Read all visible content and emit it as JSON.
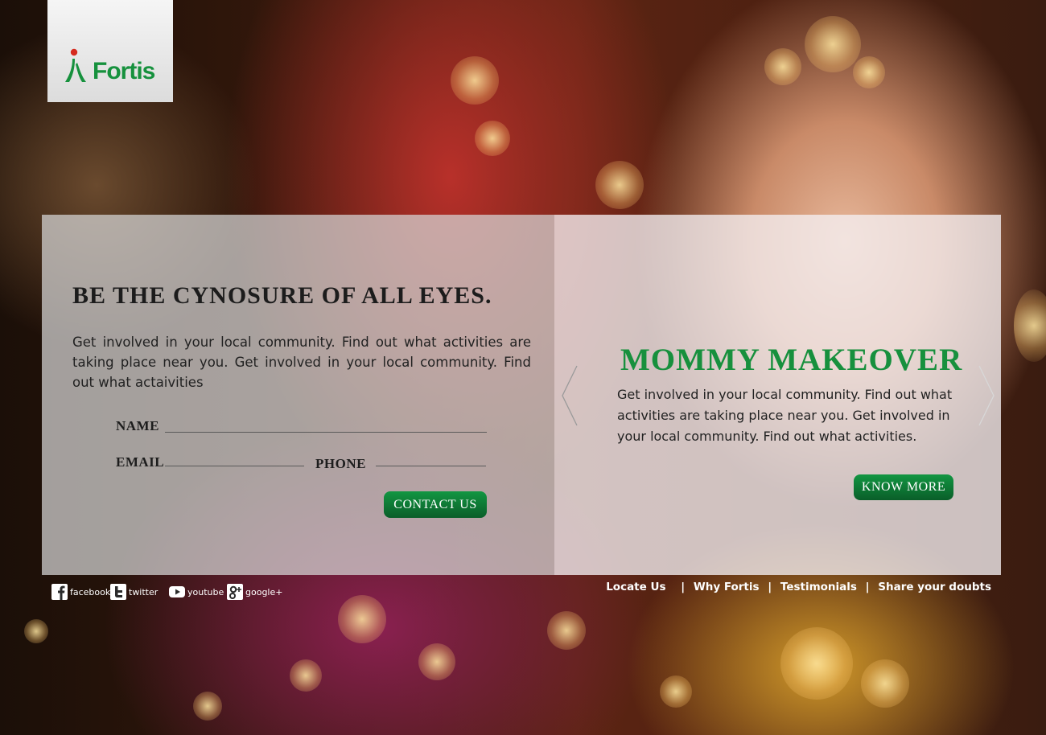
{
  "logo": {
    "text": "Fortis",
    "brand_color": "#16913d"
  },
  "left_panel": {
    "title": "BE THE CYNOSURE OF ALL EYES.",
    "text": "Get involved in your local community. Find out what activities are taking place near you. Get involved in your local community. Find out what actaivities",
    "form": {
      "name_label": "NAME",
      "email_label": "EMAIL",
      "phone_label": "PHONE",
      "name_value": "",
      "email_value": "",
      "phone_value": "",
      "submit_label": "CONTACT US"
    }
  },
  "right_panel": {
    "title": "MOMMY MAKEOVER",
    "text": "Get involved in your local community. Find out what activities are taking place near you. Get involved in your local community. Find out what activities.",
    "button_label": "KNOW MORE",
    "prev_icon": "chevron-left-icon",
    "next_icon": "chevron-right-icon"
  },
  "social": [
    {
      "label": "facebook",
      "icon": "facebook-icon"
    },
    {
      "label": "twitter",
      "icon": "twitter-icon"
    },
    {
      "label": "youtube",
      "icon": "youtube-icon"
    },
    {
      "label": "google+",
      "icon": "google-plus-icon"
    }
  ],
  "footer_links": {
    "locate": "Locate Us",
    "why": "Why Fortis",
    "testimonials": "Testimonials",
    "share": "Share your doubts",
    "separator": "|"
  },
  "colors": {
    "accent_green": "#129642",
    "panel_left": "#d7d7d7",
    "panel_right": "#f5f0f2"
  }
}
